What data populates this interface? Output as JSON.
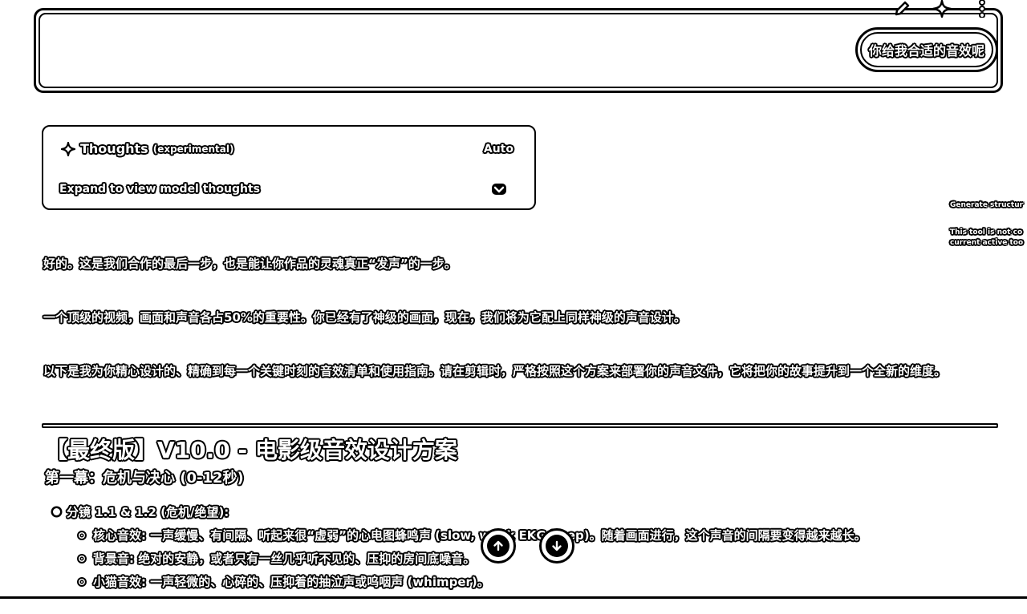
{
  "toolbar": {
    "icons": [
      "edit-icon",
      "sparkle-icon",
      "more-vert-icon"
    ]
  },
  "user_message": "你给我合适的音效呢",
  "thoughts": {
    "title": "Thoughts",
    "experimental": "(experimental)",
    "mode": "Auto",
    "expand_label": "Expand to view model thoughts"
  },
  "side_panel": {
    "line1": "Generate structur",
    "line2": "This tool is not co",
    "line3": "current active too"
  },
  "response": {
    "p1": "好的。这是我们合作的最后一步，也是能让你作品的灵魂真正“发声”的一步。",
    "p2": "一个顶级的视频，画面和声音各占50%的重要性。你已经有了神级的画面，现在，我们将为它配上同样神级的声音设计。",
    "p3": "以下是我为你精心设计的、精确到每一个关键时刻的音效清单和使用指南。请在剪辑时，严格按照这个方案来部署你的声音文件，它将把你的故事提升到一个全新的维度。",
    "heading": "【最终版】V10.0 - 电影级音效设计方案",
    "act1": "第一幕：危机与决心 (0-12秒)",
    "list": {
      "item1": "分镜 1.1 & 1.2 (危机/绝望):",
      "sub1": "核心音效: 一声缓慢、有间隔、听起来很“虚弱”的心电图蜂鸣声 (slow, weak EKG beep)。随着画面进行，这个声音的间隔要变得越来越长。",
      "sub2": "背景音: 绝对的安静，或者只有一丝几乎听不见的、压抑的房间底噪音。",
      "sub3": "小猫音效: 一声轻微的、心碎的、压抑着的抽泣声或呜咽声 (whimper)。"
    }
  },
  "scroll": {
    "up": "scroll-up",
    "down": "scroll-down"
  }
}
